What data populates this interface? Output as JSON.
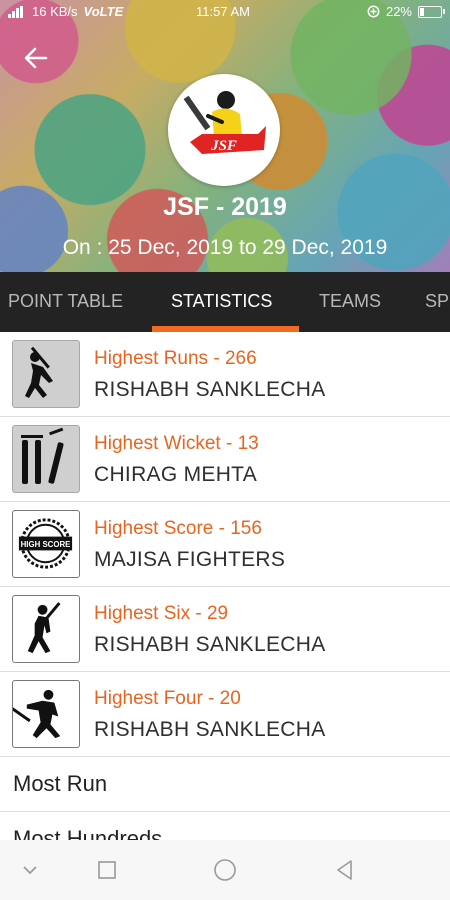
{
  "status_bar": {
    "network": "16 KB/s",
    "volte": "VoLTE",
    "time": "11:57 AM",
    "battery": "22%",
    "battery_level": 0.22
  },
  "header": {
    "logo_text": "JSF",
    "title": "JSF - 2019",
    "dates": "On : 25 Dec, 2019 to 29 Dec, 2019"
  },
  "tabs": [
    {
      "label": "POINT TABLE",
      "active": false
    },
    {
      "label": "STATISTICS",
      "active": true
    },
    {
      "label": "TEAMS",
      "active": false
    },
    {
      "label": "SP",
      "active": false
    }
  ],
  "stats": [
    {
      "label": "Highest Runs - 266",
      "value": "RISHABH SANKLECHA",
      "icon": "batsman-icon"
    },
    {
      "label": "Highest Wicket - 13",
      "value": "CHIRAG MEHTA",
      "icon": "wicket-icon"
    },
    {
      "label": "Highest Score - 156",
      "value": "MAJISA FIGHTERS",
      "icon": "high-score-icon"
    },
    {
      "label": "Highest Six - 29",
      "value": "RISHABH SANKLECHA",
      "icon": "six-hitter-icon"
    },
    {
      "label": "Highest Four - 20",
      "value": "RISHABH SANKLECHA",
      "icon": "four-hitter-icon"
    }
  ],
  "badge_text": "HIGH SCORE",
  "links": [
    "Most Run",
    "Most Hundreds"
  ],
  "colors": {
    "accent": "#f26a24",
    "tab_bar": "#232323",
    "stat_label": "#e8641f"
  }
}
